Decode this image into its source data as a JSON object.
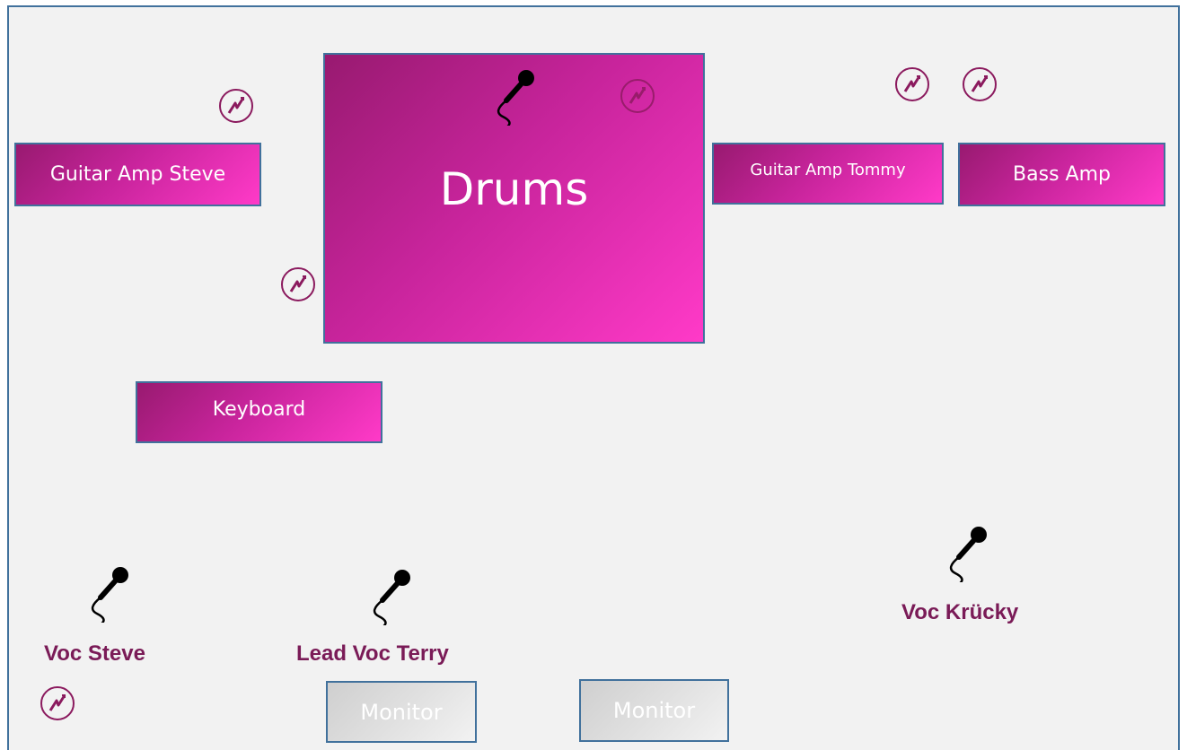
{
  "stage": {
    "drums_label": "Drums",
    "guitar_amp_steve_label": "Guitar Amp Steve",
    "guitar_amp_tommy_label": "Guitar Amp Tommy",
    "bass_amp_label": "Bass Amp",
    "keyboard_label": "Keyboard",
    "monitors": [
      "Monitor",
      "Monitor"
    ],
    "vocals": [
      "Voc Steve",
      "Lead Voc Terry",
      "Voc Krücky"
    ]
  },
  "colors": {
    "box_gradient_start": "#981a70",
    "box_gradient_end": "#ff3ac8",
    "border": "#41719c",
    "vocal_label": "#7a1b57",
    "power_icon": "#8b1a5e",
    "mic_icon": "#000000"
  },
  "icons": {
    "power": "power-outlet-icon",
    "mic": "microphone-icon"
  }
}
